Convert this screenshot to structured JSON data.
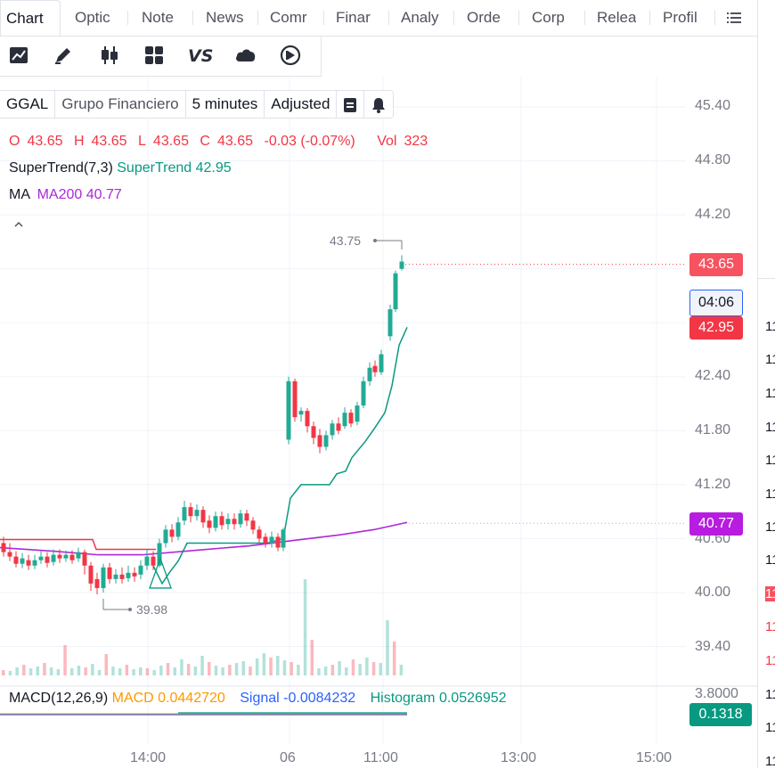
{
  "tabs": [
    "Chart",
    "Optic",
    "Note",
    "News",
    "Comr",
    "Finar",
    "Analy",
    "Orde",
    "Corp",
    "Relea",
    "Profil"
  ],
  "legend": {
    "symbol": "GGAL",
    "name": "Grupo Financiero",
    "interval": "5 minutes",
    "adjust": "Adjusted"
  },
  "ohlc": {
    "o_label": "O",
    "o": "43.65",
    "h_label": "H",
    "h": "43.65",
    "l_label": "L",
    "l": "43.65",
    "c_label": "C",
    "c": "43.65",
    "change": "-0.03 (-0.07%)",
    "vol_label": "Vol",
    "vol": "323"
  },
  "indicators": {
    "supertrend_label": "SuperTrend(7,3)",
    "supertrend_value": "SuperTrend 42.95",
    "ma_label": "MA",
    "ma_value": "MA200 40.77",
    "macd_label": "MACD(12,26,9)",
    "macd_value": "MACD 0.0442720",
    "signal_value": "Signal -0.0084232",
    "histogram_value": "Histogram 0.0526952"
  },
  "price_axis": [
    "45.40",
    "44.80",
    "44.20",
    "42.40",
    "41.80",
    "41.20",
    "40.60",
    "40.00",
    "39.40",
    "3.8000"
  ],
  "time_axis": [
    "14:00",
    "06",
    "11:00",
    "13:00",
    "15:00"
  ],
  "tags": {
    "last": "43.65",
    "countdown": "04:06",
    "supertrend": "42.95",
    "ma": "40.77",
    "macd": "0.1318"
  },
  "annotations": {
    "high": "43.75",
    "low": "39.98"
  },
  "right_axis_fragments": [
    "11",
    "11",
    "11",
    "11",
    "11",
    "11",
    "11",
    "11",
    "11",
    "11",
    "11",
    "11",
    "11",
    "11"
  ],
  "colors": {
    "up": "#22ab94",
    "down": "#f23645",
    "ma": "#ad27d8",
    "macd": "#ff9800",
    "signal": "#2962ff",
    "supertrend": "#089981"
  },
  "chart_data": {
    "type": "candlestick",
    "price_range": [
      39.2,
      45.6
    ],
    "supertrend": 42.95,
    "ma200": 40.77,
    "session_high": 43.75,
    "session_low": 39.98,
    "last_close": 43.65
  }
}
